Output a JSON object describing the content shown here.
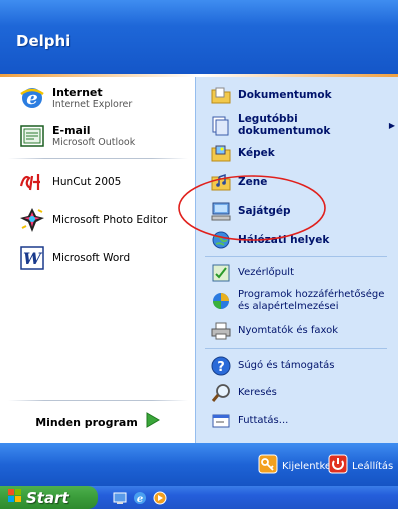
{
  "header": {
    "user_name": "Delphi"
  },
  "left_pinned": [
    {
      "title": "Internet",
      "subtitle": "Internet Explorer",
      "icon": "internet-explorer-icon"
    },
    {
      "title": "E-mail",
      "subtitle": "Microsoft Outlook",
      "icon": "outlook-icon"
    }
  ],
  "left_recent": [
    {
      "label": "HunCut 2005",
      "icon": "huncut-icon"
    },
    {
      "label": "Microsoft Photo Editor",
      "icon": "photo-editor-icon"
    },
    {
      "label": "Microsoft Word",
      "icon": "word-icon"
    }
  ],
  "all_programs": {
    "label": "Minden program"
  },
  "right_group1": [
    {
      "label": "Dokumentumok",
      "icon": "folder-documents-icon"
    },
    {
      "label": "Legutóbbi dokumentumok",
      "icon": "recent-documents-icon",
      "has_submenu": true
    },
    {
      "label": "Képek",
      "icon": "folder-pictures-icon"
    },
    {
      "label": "Zene",
      "icon": "folder-music-icon"
    },
    {
      "label": "Sajátgép",
      "icon": "my-computer-icon"
    },
    {
      "label": "Hálózati helyek",
      "icon": "network-places-icon"
    }
  ],
  "right_group2": [
    {
      "label": "Vezérlőpult",
      "icon": "control-panel-icon"
    },
    {
      "label": "Programok hozzáférhetősége és alapértelmezései",
      "label_line1": "Programok hozzáférhetősége",
      "label_line2": "és alapértelmezései",
      "icon": "program-defaults-icon"
    },
    {
      "label": "Nyomtatók és faxok",
      "icon": "printer-icon"
    }
  ],
  "right_group3": [
    {
      "label": "Súgó és támogatás",
      "icon": "help-icon"
    },
    {
      "label": "Keresés",
      "icon": "search-icon"
    },
    {
      "label": "Futtatás...",
      "icon": "run-icon"
    }
  ],
  "footer": {
    "logoff_label": "Kijelentkezés",
    "shutdown_label": "Leállítás"
  },
  "taskbar": {
    "start_label": "Start"
  },
  "colors": {
    "header": "#1e67d8",
    "right_pane": "#d3e5fa",
    "start_button": "#3a9c3a",
    "annotation_circle": "#e0201c"
  }
}
